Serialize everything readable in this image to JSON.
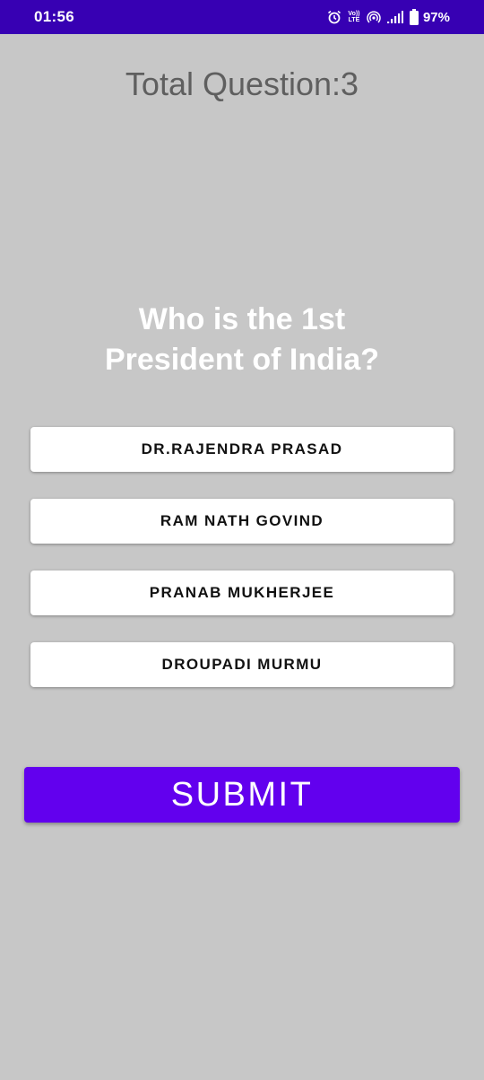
{
  "status_bar": {
    "time": "01:56",
    "volte_top": "Vo))",
    "volte_bottom": "LTE",
    "battery_percent": "97%",
    "icons": [
      "alarm-icon",
      "volte-icon",
      "hotspot-icon",
      "signal-icon",
      "battery-icon"
    ],
    "background_color": "#3700b3"
  },
  "quiz": {
    "total_question_label": "Total Question:3",
    "question_line_1": "Who is the 1st",
    "question_line_2": "President of India?",
    "options": [
      {
        "label": "DR.RAJENDRA PRASAD"
      },
      {
        "label": "RAM NATH GOVIND"
      },
      {
        "label": "PRANAB MUKHERJEE"
      },
      {
        "label": "DROUPADI MURMU"
      }
    ],
    "submit_label": "SUBMIT"
  },
  "colors": {
    "background": "#c7c7c7",
    "submit_button": "#6200ee",
    "option_button": "#ffffff",
    "total_question_text": "#5f5f5f",
    "question_text": "#ffffff"
  }
}
